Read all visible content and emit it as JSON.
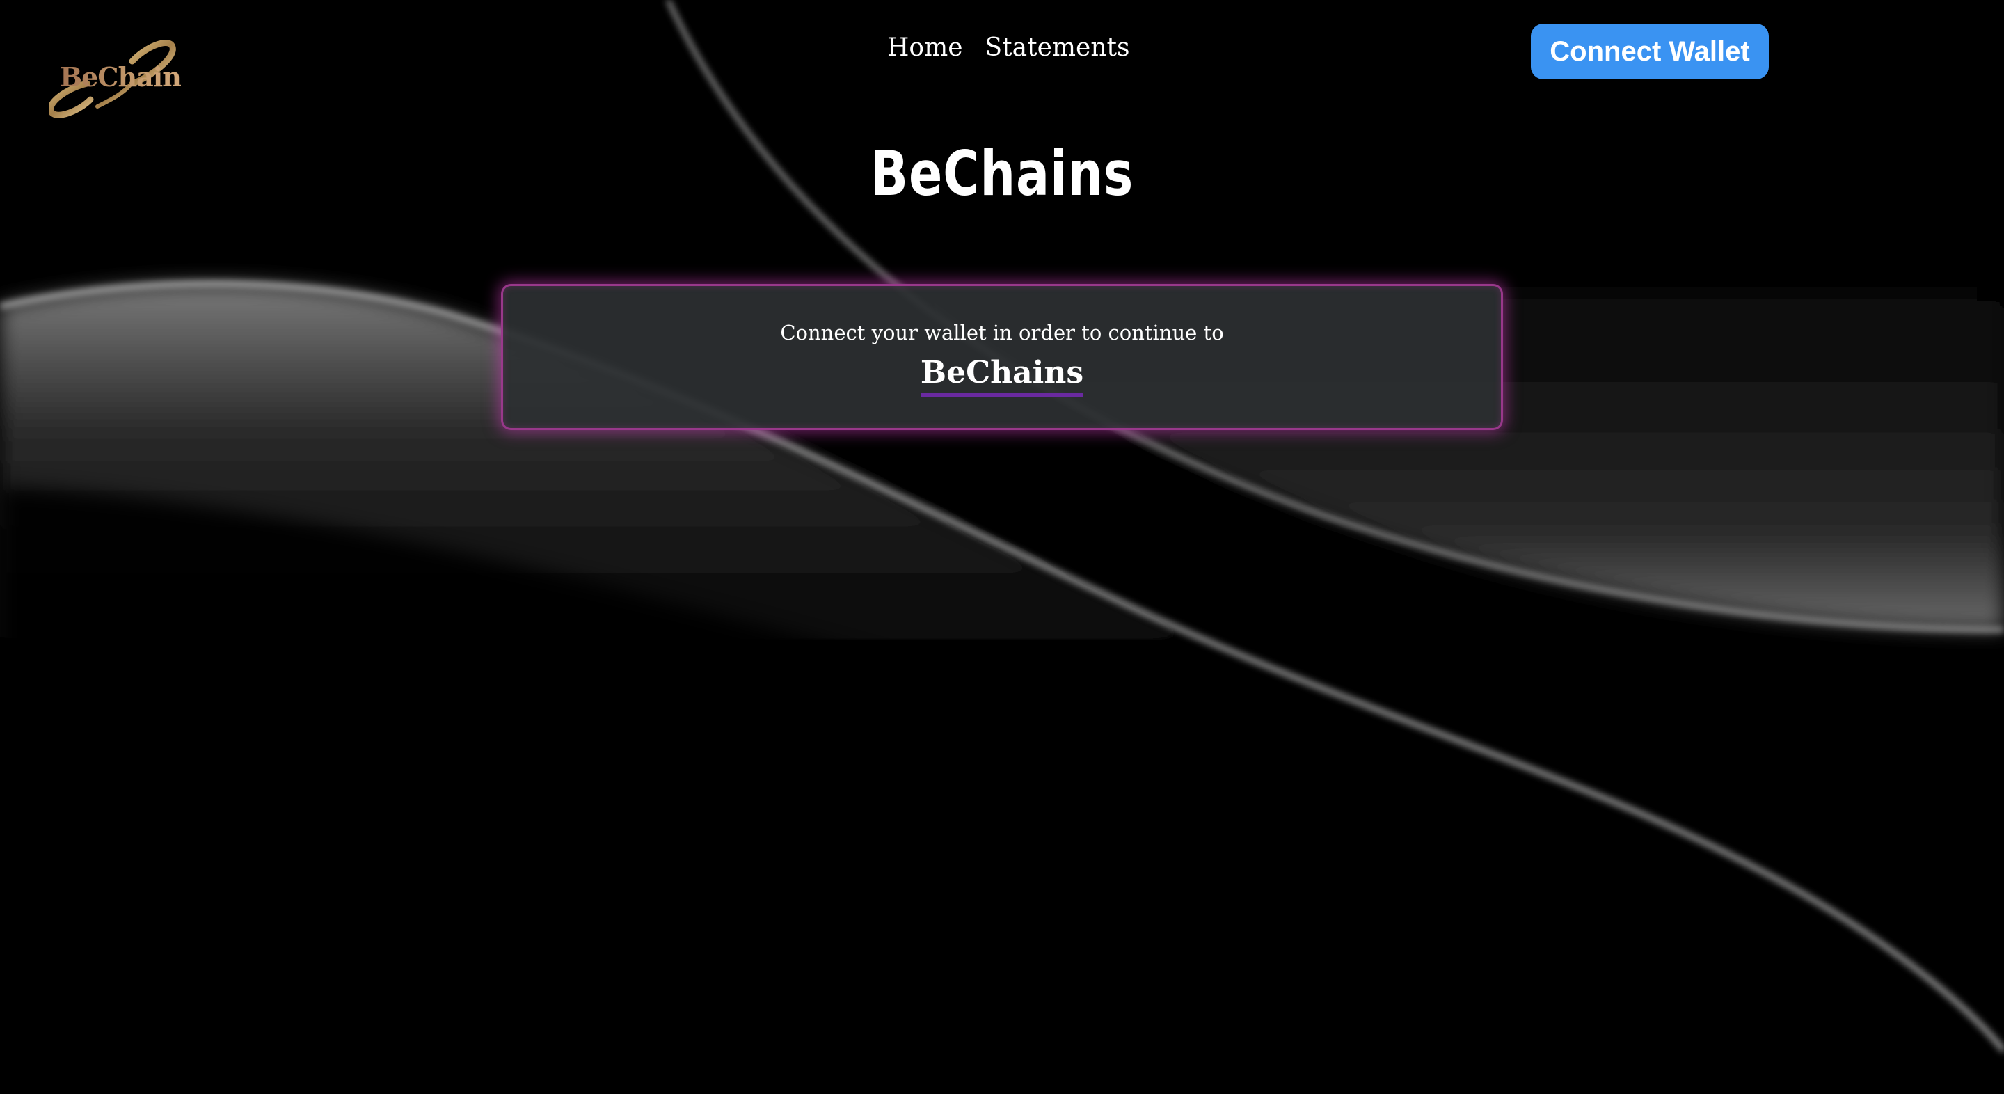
{
  "header": {
    "logo_text": "BeChain",
    "nav": [
      {
        "label": "Home"
      },
      {
        "label": "Statements"
      }
    ],
    "connect_wallet_label": "Connect Wallet"
  },
  "hero": {
    "title": "BeChains"
  },
  "card": {
    "message": "Connect your wallet in order to continue to",
    "brand": "BeChains"
  },
  "colors": {
    "button": "#3a93f2",
    "card_glow": "#c83cb4",
    "brand_underline": "#6a2aa0",
    "background": "#000000"
  }
}
